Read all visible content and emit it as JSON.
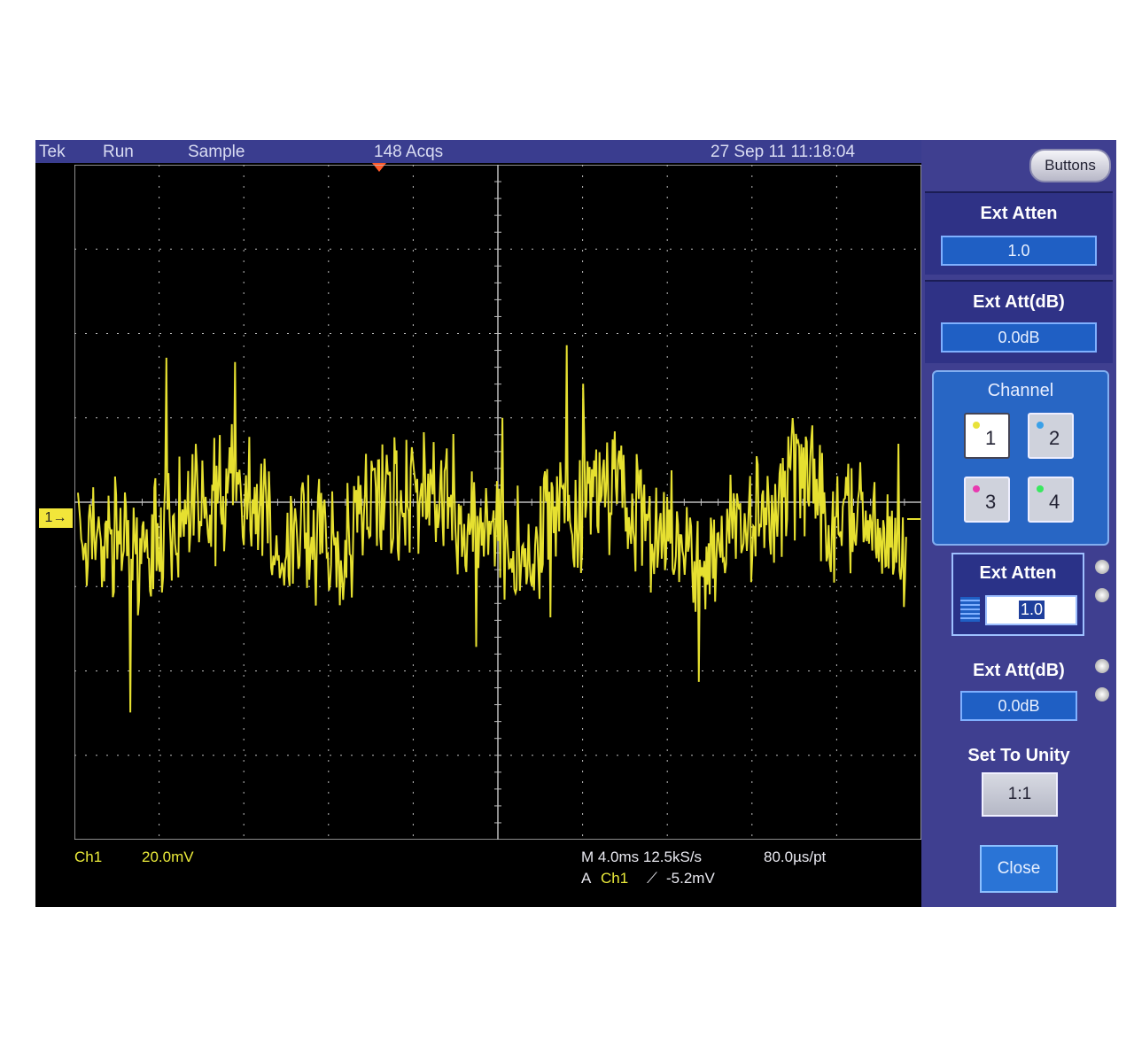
{
  "status_bar": {
    "brand": "Tek",
    "run_state": "Run",
    "acq_mode": "Sample",
    "acq_count": "148 Acqs",
    "datetime": "27 Sep 11 11:18:04"
  },
  "readouts": {
    "channel": "Ch1",
    "volts_per_div": "20.0mV",
    "timebase": "M 4.0ms 12.5kS/s",
    "time_per_point": "80.0µs/pt",
    "trigger_prefix": "A",
    "trigger_source": "Ch1",
    "trigger_slope": "⟋",
    "trigger_level": "-5.2mV"
  },
  "channel_marker": "1→",
  "panel": {
    "buttons_label": "Buttons",
    "ext_atten_label": "Ext Atten",
    "ext_atten_value": "1.0",
    "ext_att_db_label": "Ext Att(dB)",
    "ext_att_db_value": "0.0dB",
    "channel_label": "Channel",
    "channels": [
      {
        "num": "1",
        "color": "#e8e23a",
        "selected": true
      },
      {
        "num": "2",
        "color": "#3aa0e8",
        "selected": false
      },
      {
        "num": "3",
        "color": "#e83ab0",
        "selected": false
      },
      {
        "num": "4",
        "color": "#3ae860",
        "selected": false
      }
    ],
    "ext_atten2_label": "Ext Atten",
    "ext_atten2_value": "1.0",
    "ext_att_db2_label": "Ext Att(dB)",
    "ext_att_db2_value": "0.0dB",
    "set_unity_label": "Set To Unity",
    "set_unity_button": "1:1",
    "close_label": "Close"
  },
  "colors": {
    "trace": "#e6e030",
    "graticule": "#bdbdbd",
    "panel_bg": "#3f3f90",
    "accent": "#1f5fc4"
  }
}
